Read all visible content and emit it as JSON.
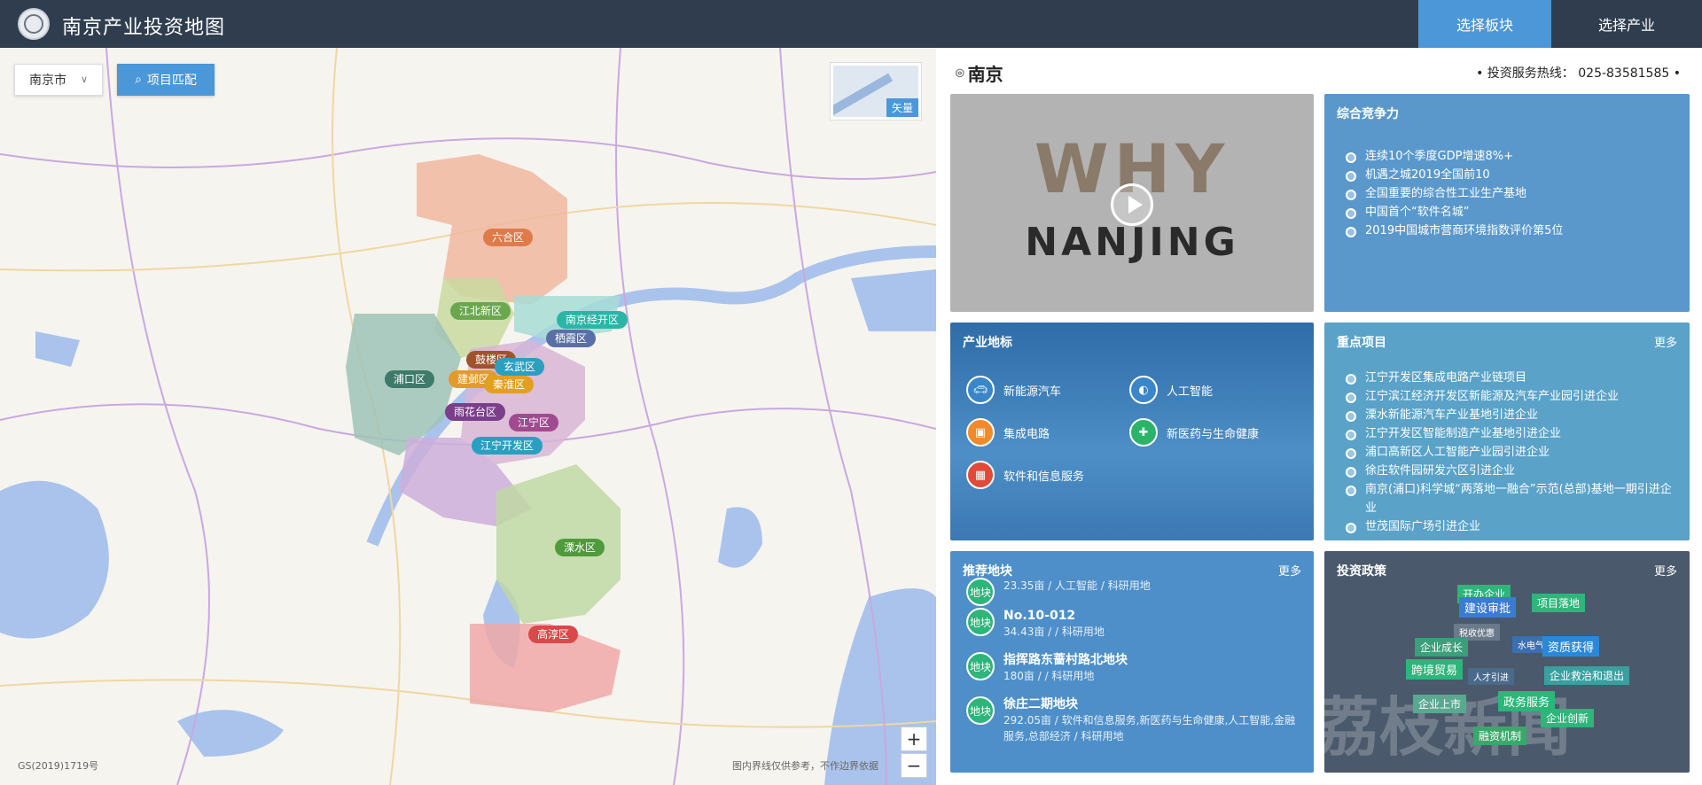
{
  "header": {
    "title": "南京产业投资地图",
    "nav": [
      {
        "label": "选择板块",
        "active": true
      },
      {
        "label": "选择产业",
        "active": false
      }
    ]
  },
  "map": {
    "city_select": "南京市",
    "match_button": "项目匹配",
    "layer_label": "矢量",
    "zoom_in": "+",
    "zoom_out": "−",
    "footer_left": "GS(2019)1719号",
    "footer_right": "图内界线仅供参考，不作边界依据",
    "districts": [
      {
        "label": "六合区",
        "color": "#e07a4a"
      },
      {
        "label": "江北新区",
        "color": "#6aa84f"
      },
      {
        "label": "南京经开区",
        "color": "#2bb5a6"
      },
      {
        "label": "栖霞区",
        "color": "#5a6fa8"
      },
      {
        "label": "鼓楼区",
        "color": "#a0522d"
      },
      {
        "label": "玄武区",
        "color": "#2a9fc0"
      },
      {
        "label": "浦口区",
        "color": "#3d7a6a"
      },
      {
        "label": "建邺区",
        "color": "#e39a2a"
      },
      {
        "label": "秦淮区",
        "color": "#e3a020"
      },
      {
        "label": "雨花台区",
        "color": "#7a3e8a"
      },
      {
        "label": "江宁区",
        "color": "#a04b8f"
      },
      {
        "label": "江宁开发区",
        "color": "#2a9fc0"
      },
      {
        "label": "溧水区",
        "color": "#4f9a3a"
      },
      {
        "label": "高淳区",
        "color": "#d9484a"
      }
    ]
  },
  "right": {
    "city_name": "南京",
    "hotline_label": "投资服务热线：",
    "hotline": "025-83581585",
    "video": {
      "line1": "WHY",
      "line2": "NANJING"
    },
    "competitiveness": {
      "title": "综合竞争力",
      "items": [
        "连续10个季度GDP增速8%+",
        "机遇之城2019全国前10",
        "全国重要的综合性工业生产基地",
        "中国首个“软件名城”",
        "2019中国城市营商环境指数评价第5位"
      ]
    },
    "industry": {
      "title": "产业地标",
      "items": [
        {
          "label": "新能源汽车",
          "icon": "car-icon",
          "color": "#3a86c8"
        },
        {
          "label": "人工智能",
          "icon": "brain-icon",
          "color": "#3a86c8"
        },
        {
          "label": "集成电路",
          "icon": "chip-icon",
          "color": "#f08a2a"
        },
        {
          "label": "新医药与生命健康",
          "icon": "medkit-icon",
          "color": "#2bb36a"
        },
        {
          "label": "软件和信息服务",
          "icon": "apps-icon",
          "color": "#e04a3a"
        }
      ]
    },
    "projects": {
      "title": "重点项目",
      "more": "更多",
      "items": [
        "江宁开发区集成电路产业链项目",
        "江宁滨江经济开发区新能源及汽车产业园引进企业",
        "溧水新能源汽车产业基地引进企业",
        "江宁开发区智能制造产业基地引进企业",
        "浦口高新区人工智能产业园引进企业",
        "徐庄软件园研发六区引进企业",
        "南京(浦口)科学城“两落地一融合”示范(总部)基地一期引进企业",
        "世茂国际广场引进企业"
      ]
    },
    "plots": {
      "title": "推荐地块",
      "more": "更多",
      "badge": "地块",
      "items": [
        {
          "name": "",
          "desc": "23.35亩 / 人工智能 / 科研用地"
        },
        {
          "name": "No.10-012",
          "desc": "34.43亩 / / 科研用地"
        },
        {
          "name": "指挥路东蔷村路北地块",
          "desc": "180亩 / / 科研用地"
        },
        {
          "name": "徐庄二期地块",
          "desc": "292.05亩 / 软件和信息服务,新医药与生命健康,人工智能,金融服务,总部经济 / 科研用地"
        }
      ]
    },
    "policy": {
      "title": "投资政策",
      "more": "更多",
      "tags": [
        {
          "label": "开办企业",
          "color": "#2db57a"
        },
        {
          "label": "建设审批",
          "color": "#3a7bd5"
        },
        {
          "label": "项目落地",
          "color": "#2db57a"
        },
        {
          "label": "税收优惠",
          "color": "#8a97a6"
        },
        {
          "label": "企业成长",
          "color": "#3a9f7a"
        },
        {
          "label": "水电气",
          "color": "#3a6fb0"
        },
        {
          "label": "资质获得",
          "color": "#2a88d8"
        },
        {
          "label": "跨境贸易",
          "color": "#2db57a"
        },
        {
          "label": "人才引进",
          "color": "#5a7faa"
        },
        {
          "label": "企业救治和退出",
          "color": "#3a9f9f"
        },
        {
          "label": "企业上市",
          "color": "#5aa88f"
        },
        {
          "label": "政务服务",
          "color": "#2db57a"
        },
        {
          "label": "企业创新",
          "color": "#2db57a"
        },
        {
          "label": "融资机制",
          "color": "#3aa86a"
        }
      ],
      "watermark": "荔枝新闻"
    }
  }
}
